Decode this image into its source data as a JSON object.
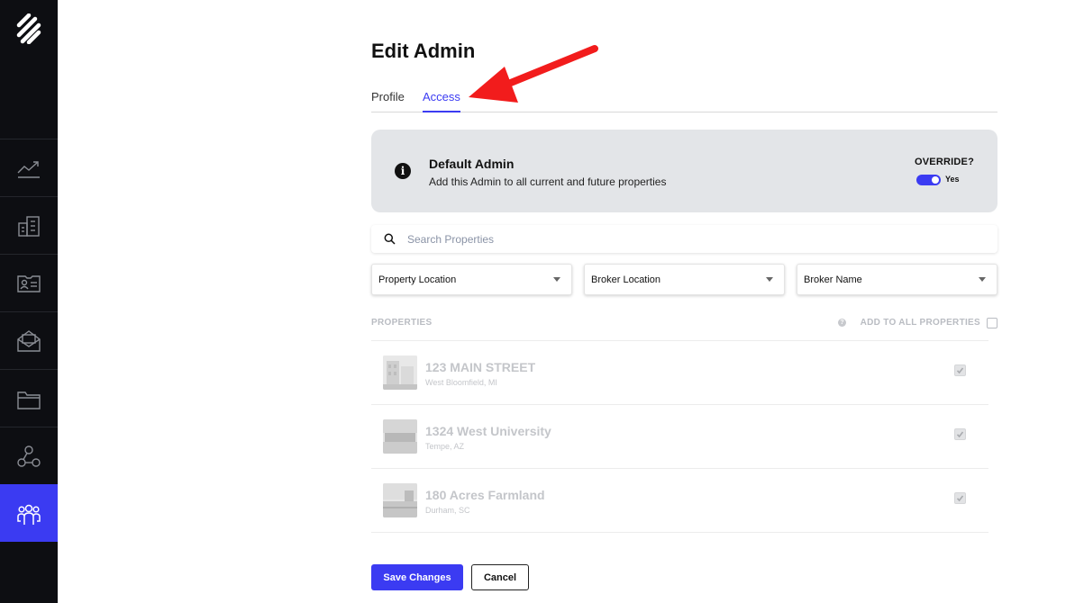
{
  "sidebar": {
    "items": [
      {
        "name": "analytics",
        "icon": "chart-line-icon",
        "active": false
      },
      {
        "name": "buildings",
        "icon": "building-icon",
        "active": false
      },
      {
        "name": "contacts",
        "icon": "id-card-icon",
        "active": false
      },
      {
        "name": "messages",
        "icon": "mail-open-icon",
        "active": false
      },
      {
        "name": "files",
        "icon": "folder-icon",
        "active": false
      },
      {
        "name": "network",
        "icon": "network-icon",
        "active": false
      },
      {
        "name": "users",
        "icon": "users-group-icon",
        "active": true
      }
    ]
  },
  "page": {
    "title": "Edit Admin",
    "tabs": [
      {
        "label": "Profile",
        "active": false
      },
      {
        "label": "Access",
        "active": true
      }
    ]
  },
  "default_admin": {
    "title": "Default Admin",
    "description": "Add this Admin to all current and future properties",
    "override_label": "OVERRIDE?",
    "toggle_on": true,
    "toggle_text": "Yes"
  },
  "search": {
    "placeholder": "Search Properties",
    "value": ""
  },
  "filters": [
    {
      "label": "Property Location"
    },
    {
      "label": "Broker Location"
    },
    {
      "label": "Broker Name"
    }
  ],
  "properties": {
    "header": "PROPERTIES",
    "add_all_label": "ADD TO ALL PROPERTIES",
    "add_all_checked": false,
    "items": [
      {
        "name": "123 MAIN STREET",
        "location": "West Bloomfield, MI",
        "checked": true
      },
      {
        "name": "1324 West University",
        "location": "Tempe, AZ",
        "checked": true
      },
      {
        "name": "180 Acres Farmland",
        "location": "Durham, SC",
        "checked": true
      }
    ]
  },
  "actions": {
    "save_label": "Save Changes",
    "cancel_label": "Cancel"
  },
  "colors": {
    "accent": "#3b3bf2",
    "sidebar_bg": "#0d0e12",
    "card_bg": "#e3e5e8",
    "annotation_arrow": "#f21c1c"
  }
}
